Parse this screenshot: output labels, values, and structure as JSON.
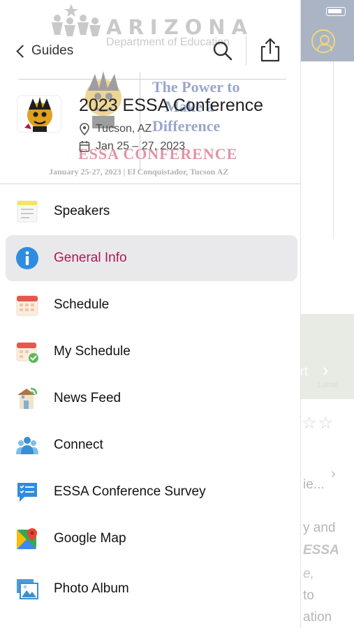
{
  "header": {
    "back_label": "Guides",
    "event_title": "2023 ESSA Conference",
    "event_location": "Tucson, AZ",
    "event_dates": "Jan 25 – 27, 2023",
    "watermark": {
      "org_title": "ARIZONA",
      "org_subtitle": "Department of Education",
      "tagline_line1": "The Power to",
      "tagline_line2": "Make a",
      "tagline_line3": "Difference",
      "conference_name": "ESSA CONFERENCE",
      "dates_venue": "January 25-27, 2023 | El Conquistador, Tucson AZ"
    }
  },
  "menu": {
    "items": [
      {
        "label": "Speakers",
        "icon": "speakers-notepad-icon",
        "active": false
      },
      {
        "label": "General Info",
        "icon": "info-icon",
        "active": true
      },
      {
        "label": "Schedule",
        "icon": "calendar-icon",
        "active": false
      },
      {
        "label": "My Schedule",
        "icon": "calendar-check-icon",
        "active": false
      },
      {
        "label": "News Feed",
        "icon": "news-feed-icon",
        "active": false
      },
      {
        "label": "Connect",
        "icon": "people-icon",
        "active": false
      },
      {
        "label": "ESSA Conference Survey",
        "icon": "survey-chat-icon",
        "active": false
      },
      {
        "label": "Google Map",
        "icon": "google-map-icon",
        "active": false
      },
      {
        "label": "Photo Album",
        "icon": "photo-album-icon",
        "active": false
      }
    ]
  },
  "background": {
    "photo_text": "rt",
    "photo_sub": "Lunal",
    "lines": [
      "ie...",
      "y and",
      "ESSA",
      "e,",
      "to",
      "ation"
    ]
  },
  "colors": {
    "active_text": "#b31650",
    "active_bg": "#e9e9eb",
    "info_blue": "#2f8ce0",
    "header_bg": "#aab4c4"
  }
}
